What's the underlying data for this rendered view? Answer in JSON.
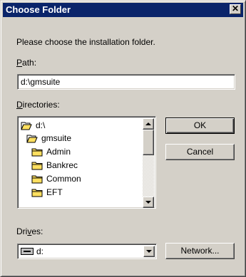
{
  "window": {
    "title": "Choose Folder"
  },
  "prompt": "Please choose the installation folder.",
  "path": {
    "label_key": "P",
    "label_rest": "ath:",
    "value": "d:\\gmsuite"
  },
  "directories": {
    "label_key": "D",
    "label_rest": "irectories:",
    "items": [
      {
        "label": "d:\\",
        "icon": "open-folder-icon"
      },
      {
        "label": "gmsuite",
        "icon": "open-folder-icon"
      },
      {
        "label": "Admin",
        "icon": "folder-icon"
      },
      {
        "label": "Bankrec",
        "icon": "folder-icon"
      },
      {
        "label": "Common",
        "icon": "folder-icon"
      },
      {
        "label": "EFT",
        "icon": "folder-icon"
      }
    ]
  },
  "drives": {
    "label_pre": "Dri",
    "label_key": "v",
    "label_post": "es:",
    "selected": "d:",
    "icon": "drive-icon"
  },
  "buttons": {
    "ok": "OK",
    "cancel": "Cancel",
    "network": "Network..."
  },
  "icons": {
    "close": "close-icon"
  },
  "colors": {
    "titlebar": "#0a246a",
    "face": "#d4d0c8"
  }
}
